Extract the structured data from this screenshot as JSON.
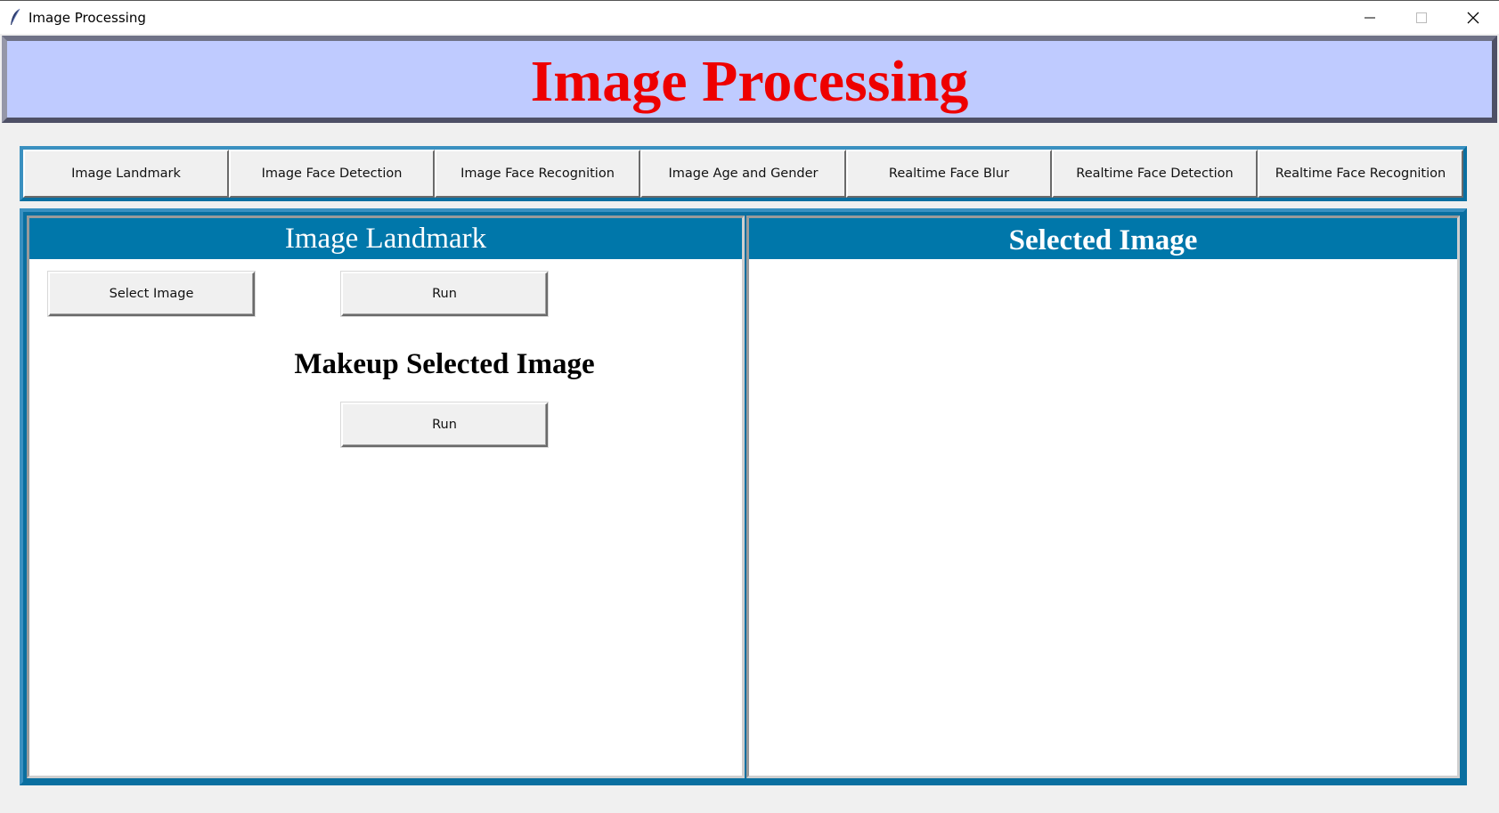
{
  "window": {
    "title": "Image Processing",
    "controls": {
      "minimize_icon": "minimize-icon",
      "maximize_icon": "maximize-icon",
      "close_icon": "close-icon"
    }
  },
  "banner": {
    "title": "Image Processing",
    "title_color": "#ee0000",
    "background": "#bfcbff"
  },
  "tabs": [
    {
      "label": "Image Landmark"
    },
    {
      "label": "Image Face Detection"
    },
    {
      "label": "Image Face Recognition"
    },
    {
      "label": "Image Age and Gender"
    },
    {
      "label": "Realtime Face Blur"
    },
    {
      "label": "Realtime Face Detection"
    },
    {
      "label": "Realtime  Face Recognition"
    }
  ],
  "left_panel": {
    "header": "Image Landmark",
    "select_button": "Select Image",
    "run_button": "Run",
    "makeup_title": "Makeup Selected Image",
    "makeup_run_button": "Run"
  },
  "right_panel": {
    "header": "Selected Image"
  },
  "colors": {
    "accent": "#0077aa",
    "frame": "#0a6fa0"
  }
}
